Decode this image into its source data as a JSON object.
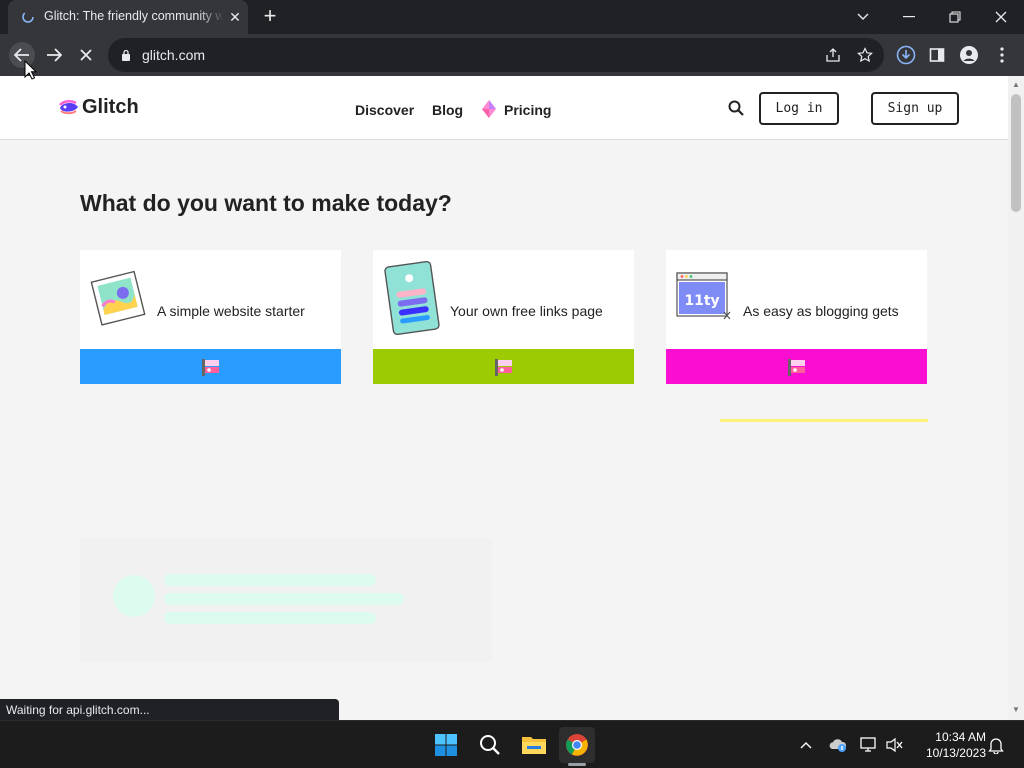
{
  "browser": {
    "tab_title": "Glitch: The friendly community where everyone builds the web",
    "tab_close_glyph": "✕",
    "newtab_glyph": "+",
    "url": "glitch.com",
    "status_text": "Waiting for api.glitch.com..."
  },
  "site": {
    "logo_text": "Glitch",
    "nav": {
      "discover": "Discover",
      "blog": "Blog",
      "pricing": "Pricing"
    },
    "login_label": "Log in",
    "signup_label": "Sign up",
    "headline": "What do you want to make today?",
    "cards": [
      {
        "label": "A simple website starter",
        "bar_color": "#2a9bff",
        "icon": "website-starter-art"
      },
      {
        "label": "Your own free links page",
        "bar_color": "#9bcb00",
        "icon": "links-page-art"
      },
      {
        "label": "As easy as blogging gets",
        "bar_color": "#fa0ed1",
        "icon": "eleventy-blog-art",
        "art_text": "11ty"
      }
    ]
  },
  "taskbar": {
    "time": "10:34 AM",
    "date": "10/13/2023"
  },
  "colors": {
    "chrome_dark": "#202124",
    "chrome_mid": "#35363a",
    "page_bg": "#f4f4f4",
    "skeleton": "#dcfbee",
    "accent_yellow": "#fdf27a"
  }
}
